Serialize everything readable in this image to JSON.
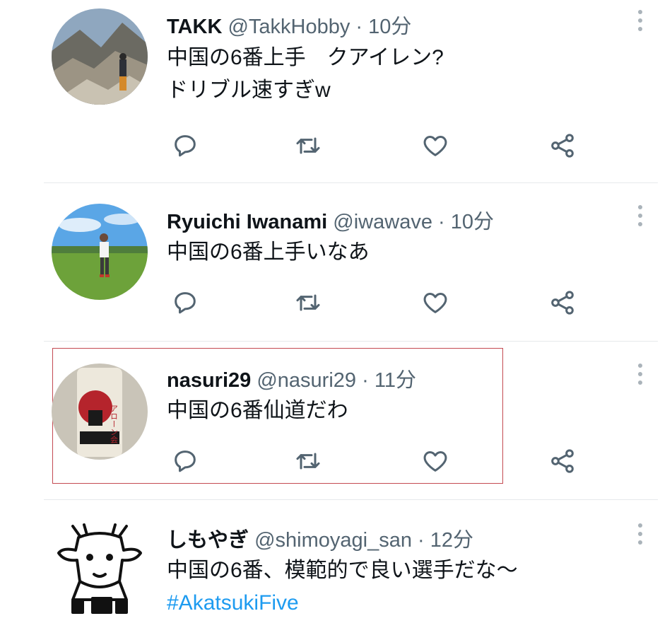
{
  "colors": {
    "text": "#0f1419",
    "secondary": "#536471",
    "hashtag": "#1d9bf0",
    "highlight_border": "#c44a52"
  },
  "tweets": [
    {
      "name": "TAKK",
      "handle": "@TakkHobby",
      "separator": "·",
      "time": "10分",
      "line1": "中国の6番上手　クアイレン?",
      "line2": "ドリブル速すぎw",
      "avatar": "mountain-hiker-photo"
    },
    {
      "name": "Ryuichi Iwanami",
      "handle": "@iwawave",
      "separator": "·",
      "time": "10分",
      "line1": "中国の6番上手いなあ",
      "avatar": "person-on-grass-photo"
    },
    {
      "name": "nasuri29",
      "handle": "@nasuri29",
      "separator": "·",
      "time": "11分",
      "line1": "中国の6番仙道だわ",
      "avatar": "afro-keychain-photo",
      "avatar_text": "アローン会"
    },
    {
      "name": "しもやぎ",
      "handle": "@shimoyagi_san",
      "separator": "·",
      "time": "12分",
      "line1": "中国の6番、模範的で良い選手だな〜",
      "hashtag": "#AkatsukiFive",
      "avatar": "goat-illustration"
    }
  ],
  "action_icons": [
    "reply-icon",
    "retweet-icon",
    "like-icon",
    "share-icon"
  ]
}
